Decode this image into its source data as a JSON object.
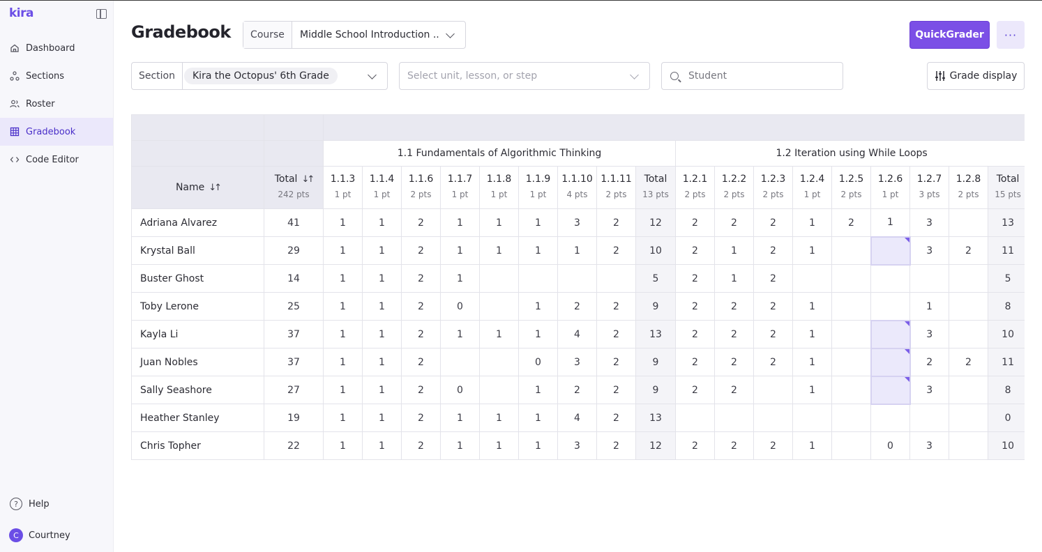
{
  "app": {
    "logo_text": "kira"
  },
  "sidebar": {
    "items": [
      {
        "label": "Dashboard",
        "icon": "home-icon"
      },
      {
        "label": "Sections",
        "icon": "sections-icon"
      },
      {
        "label": "Roster",
        "icon": "roster-icon"
      },
      {
        "label": "Gradebook",
        "icon": "grid-icon",
        "active": true
      },
      {
        "label": "Code Editor",
        "icon": "code-icon"
      }
    ],
    "help_label": "Help",
    "user": {
      "initial": "C",
      "name": "Courtney"
    }
  },
  "header": {
    "title": "Gradebook",
    "course_label": "Course",
    "course_value": "Middle School Introduction ...",
    "quickgrader_label": "QuickGrader",
    "more_label": "···"
  },
  "filters": {
    "section_label": "Section",
    "section_value": "Kira the Octopus' 6th Grade",
    "unit_placeholder": "Select unit, lesson, or step",
    "student_placeholder": "Student",
    "grade_display_label": "Grade display"
  },
  "colors": {
    "accent": "#7b4fe6",
    "pending_cell": "#ebe9fb",
    "header_bg": "#e9e9f1"
  },
  "gradebook": {
    "name_header": "Name",
    "total_header": "Total",
    "total_points": "242 pts",
    "units": [
      {
        "title": "1.1 Fundamentals of Algorithmic Thinking",
        "steps": [
          {
            "label": "1.1.3",
            "pts": "1 pt"
          },
          {
            "label": "1.1.4",
            "pts": "1 pt"
          },
          {
            "label": "1.1.6",
            "pts": "2 pts"
          },
          {
            "label": "1.1.7",
            "pts": "1 pt"
          },
          {
            "label": "1.1.8",
            "pts": "1 pt"
          },
          {
            "label": "1.1.9",
            "pts": "1 pt"
          },
          {
            "label": "1.1.10",
            "pts": "4 pts"
          },
          {
            "label": "1.1.11",
            "pts": "2 pts"
          }
        ],
        "total_label": "Total",
        "total_pts": "13 pts"
      },
      {
        "title": "1.2 Iteration using While Loops",
        "steps": [
          {
            "label": "1.2.1",
            "pts": "2 pts"
          },
          {
            "label": "1.2.2",
            "pts": "2 pts"
          },
          {
            "label": "1.2.3",
            "pts": "2 pts"
          },
          {
            "label": "1.2.4",
            "pts": "1 pt"
          },
          {
            "label": "1.2.5",
            "pts": "2 pts"
          },
          {
            "label": "1.2.6",
            "pts": "1 pt"
          },
          {
            "label": "1.2.7",
            "pts": "3 pts"
          },
          {
            "label": "1.2.8",
            "pts": "2 pts"
          }
        ],
        "total_label": "Total",
        "total_pts": "15 pts"
      }
    ],
    "students": [
      {
        "name": "Adriana Alvarez",
        "total": "41",
        "u1": [
          "1",
          "1",
          "2",
          "1",
          "1",
          "1",
          "3",
          "2"
        ],
        "u1_total": "12",
        "u2": [
          "2",
          "2",
          "2",
          "1",
          "2",
          "1",
          "3",
          ""
        ],
        "u2_total": "13",
        "pending": []
      },
      {
        "name": "Krystal Ball",
        "total": "29",
        "u1": [
          "1",
          "1",
          "2",
          "1",
          "1",
          "1",
          "1",
          "2"
        ],
        "u1_total": "10",
        "u2": [
          "2",
          "1",
          "2",
          "1",
          "",
          "",
          "3",
          "2"
        ],
        "u2_total": "11",
        "pending": [
          5
        ]
      },
      {
        "name": "Buster Ghost",
        "total": "14",
        "u1": [
          "1",
          "1",
          "2",
          "1",
          "",
          "",
          "",
          ""
        ],
        "u1_total": "5",
        "u2": [
          "2",
          "1",
          "2",
          "",
          "",
          "",
          "",
          ""
        ],
        "u2_total": "5",
        "pending": []
      },
      {
        "name": "Toby Lerone",
        "total": "25",
        "u1": [
          "1",
          "1",
          "2",
          "0",
          "",
          "1",
          "2",
          "2"
        ],
        "u1_total": "9",
        "u2": [
          "2",
          "2",
          "2",
          "1",
          "",
          "",
          "1",
          ""
        ],
        "u2_total": "8",
        "pending": []
      },
      {
        "name": "Kayla Li",
        "total": "37",
        "u1": [
          "1",
          "1",
          "2",
          "1",
          "1",
          "1",
          "4",
          "2"
        ],
        "u1_total": "13",
        "u2": [
          "2",
          "2",
          "2",
          "1",
          "",
          "",
          "3",
          ""
        ],
        "u2_total": "10",
        "pending": [
          5
        ]
      },
      {
        "name": "Juan Nobles",
        "total": "37",
        "u1": [
          "1",
          "1",
          "2",
          "",
          "",
          "0",
          "3",
          "2"
        ],
        "u1_total": "9",
        "u2": [
          "2",
          "2",
          "2",
          "1",
          "",
          "",
          "2",
          "2"
        ],
        "u2_total": "11",
        "pending": [
          5
        ]
      },
      {
        "name": "Sally Seashore",
        "total": "27",
        "u1": [
          "1",
          "1",
          "2",
          "0",
          "",
          "1",
          "2",
          "2"
        ],
        "u1_total": "9",
        "u2": [
          "2",
          "2",
          "",
          "1",
          "",
          "",
          "3",
          ""
        ],
        "u2_total": "8",
        "pending": [
          5
        ]
      },
      {
        "name": "Heather Stanley",
        "total": "19",
        "u1": [
          "1",
          "1",
          "2",
          "1",
          "1",
          "1",
          "4",
          "2"
        ],
        "u1_total": "13",
        "u2": [
          "",
          "",
          "",
          "",
          "",
          "",
          "",
          ""
        ],
        "u2_total": "0",
        "pending": []
      },
      {
        "name": "Chris Topher",
        "total": "22",
        "u1": [
          "1",
          "1",
          "2",
          "1",
          "1",
          "1",
          "3",
          "2"
        ],
        "u1_total": "12",
        "u2": [
          "2",
          "2",
          "2",
          "1",
          "",
          "0",
          "3",
          ""
        ],
        "u2_total": "10",
        "pending": []
      }
    ]
  }
}
